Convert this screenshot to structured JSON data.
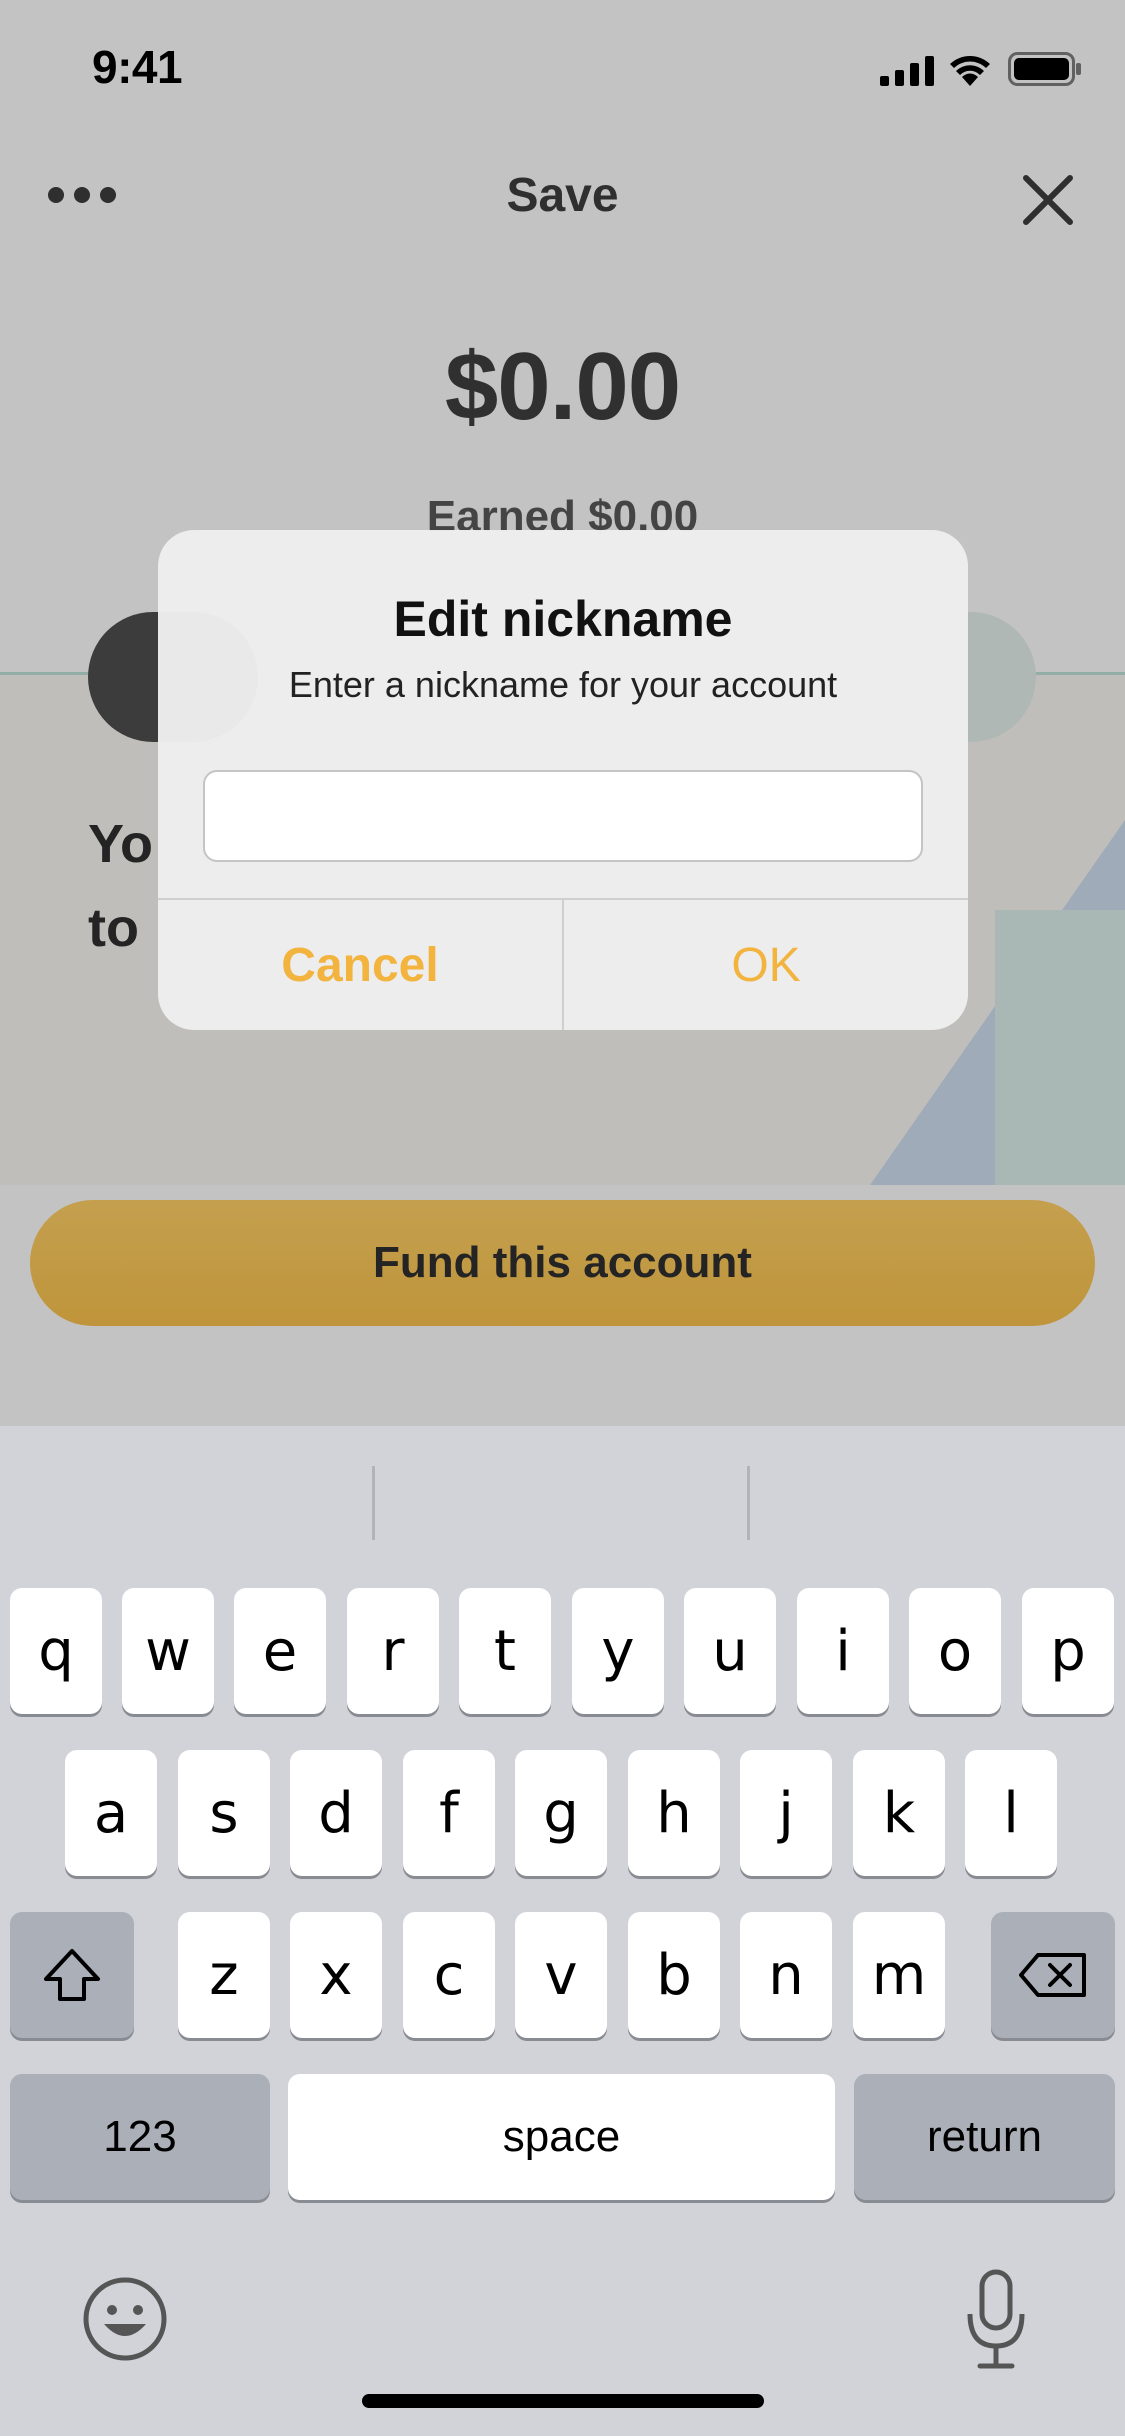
{
  "status_bar": {
    "time": "9:41",
    "icons": [
      "cellular-signal-icon",
      "wifi-icon",
      "battery-icon"
    ]
  },
  "nav": {
    "title": "Save",
    "left_icon": "more-icon",
    "right_icon": "close-icon"
  },
  "account": {
    "balance": "$0.00",
    "earned": "Earned $0.00",
    "description_visible": "Yo\nto"
  },
  "fund_button": {
    "label": "Fund this account"
  },
  "dialog": {
    "title": "Edit nickname",
    "message": "Enter a nickname for your account",
    "input_value": "",
    "cancel_label": "Cancel",
    "ok_label": "OK"
  },
  "keyboard": {
    "row1": [
      "q",
      "w",
      "e",
      "r",
      "t",
      "y",
      "u",
      "i",
      "o",
      "p"
    ],
    "row2": [
      "a",
      "s",
      "d",
      "f",
      "g",
      "h",
      "j",
      "k",
      "l"
    ],
    "row3": [
      "z",
      "x",
      "c",
      "v",
      "b",
      "n",
      "m"
    ],
    "numbers_label": "123",
    "space_label": "space",
    "return_label": "return",
    "icons": [
      "shift-icon",
      "delete-icon",
      "emoji-icon",
      "microphone-icon"
    ]
  },
  "colors": {
    "accent": "#F2B43F",
    "fund_button": "#F0BA4A",
    "keyboard_bg": "#D1D3D9"
  }
}
